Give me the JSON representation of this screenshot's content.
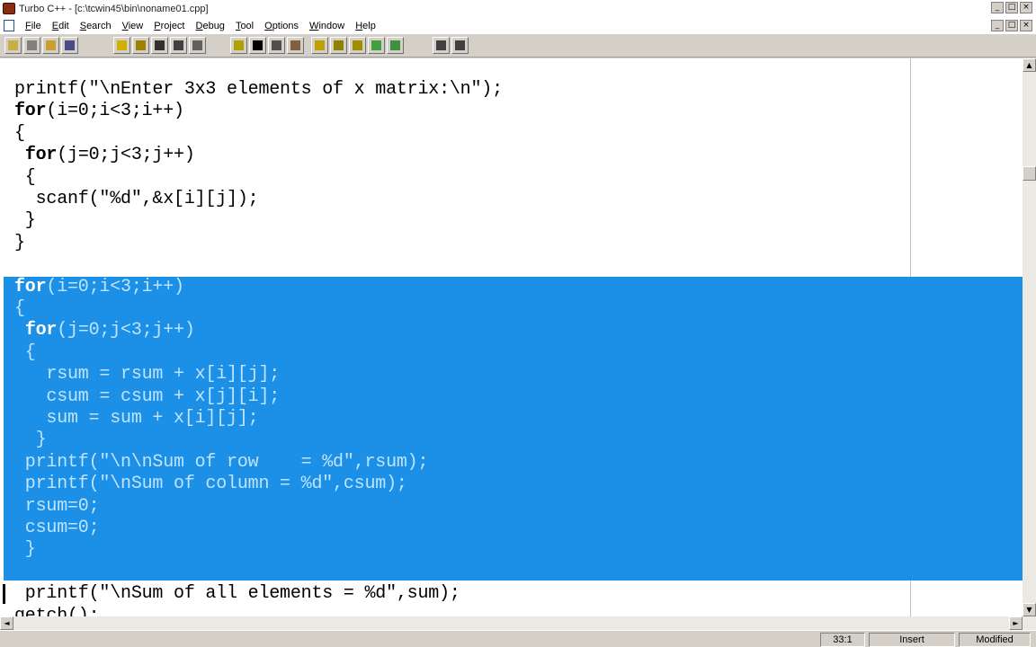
{
  "window": {
    "title": "Turbo C++ - [c:\\tcwin45\\bin\\noname01.cpp]"
  },
  "window_buttons": {
    "minimize": "_",
    "restore": "□",
    "close": "×"
  },
  "menu": {
    "items": [
      "File",
      "Edit",
      "Search",
      "View",
      "Project",
      "Debug",
      "Tool",
      "Options",
      "Window",
      "Help"
    ]
  },
  "toolbar": {
    "buttons": [
      {
        "name": "open-project-icon",
        "color": "#c8b040"
      },
      {
        "name": "save-project-icon",
        "color": "#808080"
      },
      {
        "name": "open-file-icon",
        "color": "#c8a030"
      },
      {
        "name": "save-file-icon",
        "color": "#4a4a8a"
      },
      {
        "name": "compile-icon",
        "color": "#d0b000"
      },
      {
        "name": "make-icon",
        "color": "#a08000"
      },
      {
        "name": "build-icon",
        "color": "#303030"
      },
      {
        "name": "run-icon",
        "color": "#404040"
      },
      {
        "name": "step-icon",
        "color": "#606060"
      },
      {
        "name": "undo-icon",
        "color": "#b0a000"
      },
      {
        "name": "cut-icon",
        "color": "#000000"
      },
      {
        "name": "copy-icon",
        "color": "#505050"
      },
      {
        "name": "paste-icon",
        "color": "#806040"
      },
      {
        "name": "search-icon",
        "color": "#c0a000"
      },
      {
        "name": "replace-icon",
        "color": "#908000"
      },
      {
        "name": "search-again-icon",
        "color": "#a09000"
      },
      {
        "name": "browse-icon",
        "color": "#40a040"
      },
      {
        "name": "inspect-icon",
        "color": "#409040"
      },
      {
        "name": "help-topic-icon",
        "color": "#404040"
      },
      {
        "name": "help-index-icon",
        "color": "#404040"
      }
    ]
  },
  "editor": {
    "lines_before": [
      "printf(\"\\nEnter 3x3 elements of x matrix:\\n\");",
      "for(i=0;i<3;i++)",
      "{",
      " for(j=0;j<3;j++)",
      " {",
      "  scanf(\"%d\",&x[i][j]);",
      " }",
      "}"
    ],
    "selected_lines": [
      "for(i=0;i<3;i++)",
      "{",
      " for(j=0;j<3;j++)",
      " {",
      "   rsum = rsum + x[i][j];",
      "   csum = csum + x[j][i];",
      "   sum = sum + x[i][j];",
      "  }",
      " printf(\"\\n\\nSum of row    = %d\",rsum);",
      " printf(\"\\nSum of column = %d\",csum);",
      " rsum=0;",
      " csum=0;",
      " }"
    ],
    "lines_after": [
      " printf(\"\\nSum of all elements = %d\",sum);",
      "getch();"
    ],
    "selection_color": "#1c8fe6"
  },
  "scrollbars": {
    "up": "▲",
    "down": "▼",
    "left": "◄",
    "right": "►"
  },
  "statusbar": {
    "position": "33:1",
    "mode": "Insert",
    "state": "Modified"
  }
}
